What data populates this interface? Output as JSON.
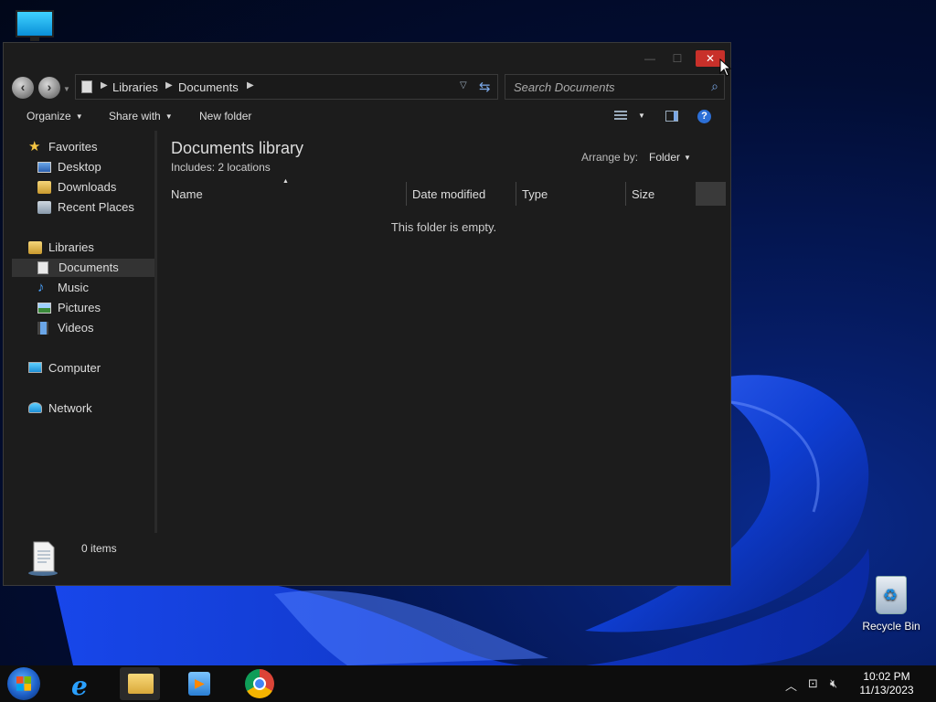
{
  "desktop": {
    "recycle_bin_label": "Recycle Bin"
  },
  "window": {
    "controls": {
      "minimize": "—",
      "maximize": "☐",
      "close": "✕"
    },
    "address": {
      "crumbs": [
        "Libraries",
        "Documents"
      ]
    },
    "search": {
      "placeholder": "Search Documents"
    },
    "toolbar": {
      "organize": "Organize",
      "share_with": "Share with",
      "new_folder": "New folder"
    },
    "nav": {
      "favorites": "Favorites",
      "desktop": "Desktop",
      "downloads": "Downloads",
      "recent_places": "Recent Places",
      "libraries": "Libraries",
      "documents": "Documents",
      "music": "Music",
      "pictures": "Pictures",
      "videos": "Videos",
      "computer": "Computer",
      "network": "Network"
    },
    "content": {
      "title": "Documents library",
      "includes_label": "Includes:",
      "includes_value": "2 locations",
      "arrange_by_label": "Arrange by:",
      "arrange_by_value": "Folder",
      "columns": [
        "Name",
        "Date modified",
        "Type",
        "Size"
      ],
      "empty_message": "This folder is empty."
    },
    "status": {
      "item_count": "0 items"
    }
  },
  "taskbar": {
    "apps": [
      "internet-explorer",
      "file-explorer",
      "media-player",
      "chrome"
    ],
    "time": "10:02 PM",
    "date": "11/13/2023"
  },
  "colors": {
    "close_button": "#c8302a",
    "window_bg": "#1c1c1c",
    "taskbar_bg": "#0d0d0d"
  }
}
